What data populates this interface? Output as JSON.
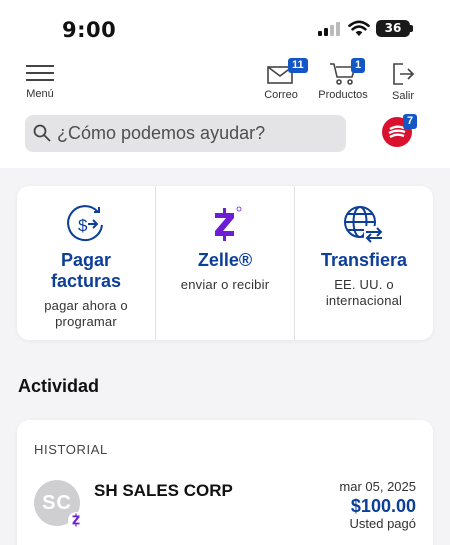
{
  "status_bar": {
    "time": "9:00",
    "battery": "36"
  },
  "nav": {
    "menu_label": "Menú",
    "mail_label": "Correo",
    "mail_badge": "11",
    "products_label": "Productos",
    "products_badge": "1",
    "exit_label": "Salir"
  },
  "search": {
    "placeholder": "¿Cómo podemos ayudar?",
    "assistant_badge": "7"
  },
  "actions": [
    {
      "title_line1": "Pagar",
      "title_line2": "facturas",
      "sub_line1": "pagar ahora o",
      "sub_line2": "programar",
      "icon": "pay-bills-icon"
    },
    {
      "title_line1": "Zelle®",
      "title_line2": "",
      "sub_line1": "enviar o recibir",
      "sub_line2": "",
      "icon": "zelle-icon"
    },
    {
      "title_line1": "Transfiera",
      "title_line2": "",
      "sub_line1": "EE. UU. o",
      "sub_line2": "internacional",
      "icon": "global-transfer-icon"
    }
  ],
  "activity": {
    "title": "Actividad",
    "history_label": "HISTORIAL",
    "transactions": [
      {
        "initials": "SC",
        "name": "SH SALES CORP",
        "date": "mar 05, 2025",
        "amount": "$100.00",
        "note": "Usted pagó"
      }
    ]
  },
  "colors": {
    "brand_blue": "#0d3f99",
    "badge_blue": "#1356c5",
    "zelle_purple": "#6d1ed4",
    "brand_red": "#d9112e"
  }
}
